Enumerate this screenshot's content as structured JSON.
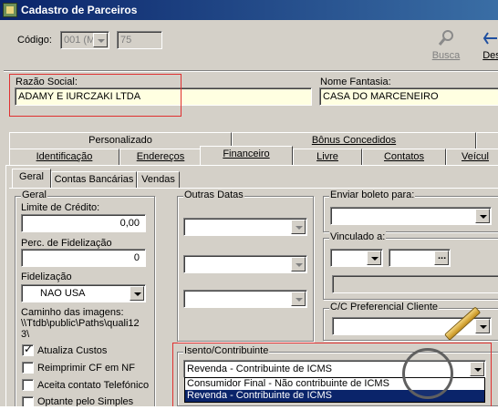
{
  "window": {
    "title": "Cadastro de Parceiros"
  },
  "header": {
    "codigo_label": "Código:",
    "codigo_combo_value": "001 (M",
    "codigo_number_value": "75",
    "busca_label": "Busca",
    "desfazer_label": "Des"
  },
  "razao": {
    "label": "Razão Social:",
    "value": "ADAMY E IURCZAKI LTDA"
  },
  "fantasia": {
    "label": "Nome Fantasia:",
    "value": "CASA DO MARCENEIRO"
  },
  "tabs_top": [
    "Personalizado",
    "Bônus Concedidos"
  ],
  "tabs_main": [
    "Identificação",
    "Endereços",
    "Financeiro",
    "Livre",
    "Contatos",
    "Veícul"
  ],
  "subtabs": [
    "Geral",
    "Contas Bancárias",
    "Vendas"
  ],
  "geral": {
    "title": "Geral",
    "limite_label": "Limite de Crédito:",
    "limite_value": "0,00",
    "perc_label": "Perc. de Fidelização",
    "perc_value": "0",
    "fidelizacao_label": "Fidelização",
    "fidelizacao_value": "NAO USA",
    "caminho_label": "Caminho das imagens:",
    "caminho_value_1": "\\\\Ttdb\\public\\Paths\\quali12",
    "caminho_value_2": "3\\",
    "checks": [
      {
        "label": "Atualiza Custos",
        "checked": true
      },
      {
        "label": "Reimprimir CF em NF",
        "checked": false
      },
      {
        "label": "Aceita contato Telefónico",
        "checked": false
      },
      {
        "label": "Optante pelo Simples",
        "checked": false
      }
    ]
  },
  "outras_datas": {
    "title": "Outras Datas"
  },
  "enviar_boleto": {
    "title": "Enviar boleto para:"
  },
  "vinculado": {
    "title": "Vinculado a:"
  },
  "cc_preferencial": {
    "title": "C/C Preferencial Cliente"
  },
  "isento": {
    "title": "Isento/Contribuinte",
    "value": "Revenda - Contribuinte de ICMS",
    "options": [
      "Consumidor Final - Não contribuinte de ICMS",
      "Revenda - Contribuinte de ICMS"
    ],
    "selected_index": 1
  },
  "colors": {
    "title_bar": "#0a246a",
    "highlight_box": "#e03030",
    "field_focus": "#ffffe1"
  }
}
